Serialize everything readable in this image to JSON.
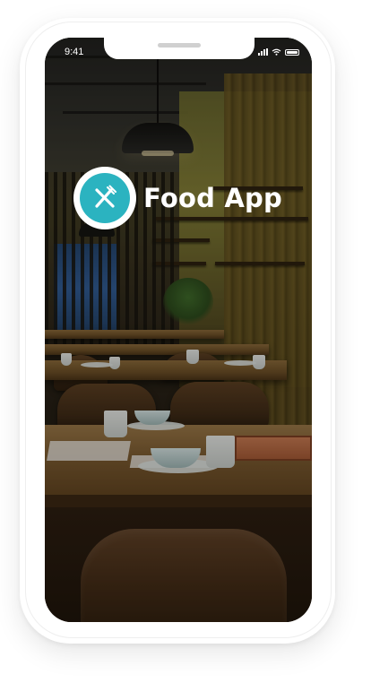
{
  "status_bar": {
    "time": "9:41"
  },
  "brand": {
    "title": "Food App",
    "logo_icon": "fork-knife-icon",
    "accent_color": "#2bb3c0"
  },
  "background": {
    "image_icon": "restaurant-interior-photo"
  }
}
